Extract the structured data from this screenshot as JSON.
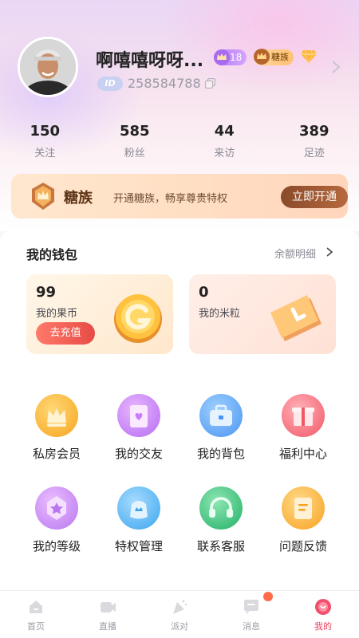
{
  "profile": {
    "nickname": "啊嘻嘻呀呀...",
    "level": "18",
    "clan_badge": "糖族",
    "id_tag": "ID",
    "uid": "258584788"
  },
  "stats": [
    {
      "value": "150",
      "label": "关注"
    },
    {
      "value": "585",
      "label": "粉丝"
    },
    {
      "value": "44",
      "label": "来访"
    },
    {
      "value": "389",
      "label": "足迹"
    }
  ],
  "vip": {
    "title": "糖族",
    "desc": "开通糖族，畅享尊贵特权",
    "button": "立即开通"
  },
  "wallet": {
    "title": "我的钱包",
    "detail_link": "余额明细",
    "coins": {
      "value": "99",
      "label": "我的果币",
      "button": "去充值"
    },
    "rice": {
      "value": "0",
      "label": "我的米粒"
    }
  },
  "grid": [
    {
      "label": "私房会员",
      "icon": "crown-icon",
      "color": "#ffb42e"
    },
    {
      "label": "我的交友",
      "icon": "friend-card-icon",
      "color": "#c77dff"
    },
    {
      "label": "我的背包",
      "icon": "backpack-icon",
      "color": "#5aa7ff"
    },
    {
      "label": "福利中心",
      "icon": "gift-icon",
      "color": "#ff6a78"
    },
    {
      "label": "我的等级",
      "icon": "star-level-icon",
      "color": "#c77dff"
    },
    {
      "label": "特权管理",
      "icon": "privilege-icon",
      "color": "#4ab6f5"
    },
    {
      "label": "联系客服",
      "icon": "headset-icon",
      "color": "#35c27a"
    },
    {
      "label": "问题反馈",
      "icon": "feedback-icon",
      "color": "#ffae2e"
    }
  ],
  "tabs": [
    {
      "label": "首页",
      "icon": "home-icon"
    },
    {
      "label": "直播",
      "icon": "live-icon"
    },
    {
      "label": "派对",
      "icon": "party-icon"
    },
    {
      "label": "消息",
      "icon": "message-icon"
    },
    {
      "label": "我的",
      "icon": "me-icon",
      "active": true
    }
  ],
  "colors": {
    "accent": "#e5455d",
    "vip_button": "#9a5430",
    "recharge": "#e64b45"
  }
}
